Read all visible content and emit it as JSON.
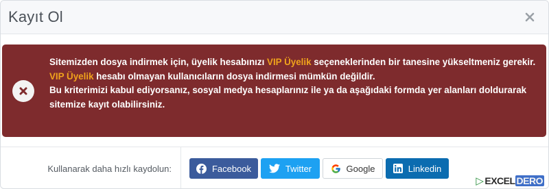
{
  "modal": {
    "title": "Kayıt Ol",
    "close_label": "×"
  },
  "alert": {
    "line1_pre": "Sitemizden dosya indirmek için, üyelik hesabınızı ",
    "line1_highlight": "VIP Üyelik",
    "line1_post": " seçeneklerinden bir tanesine yükseltmeniz gerekir.",
    "line2_highlight": "VIP Üyelik",
    "line2_post": " hesabı olmayan kullanıcıların dosya indirmesi mümkün değildir.",
    "line3": "Bu kriterimizi kabul ediyorsanız, sosyal medya hesaplarınız ile ya da aşağıdaki formda yer alanları doldurarak sitemize kayıt olabilirsiniz.",
    "icon": "x-circle-icon",
    "background_color": "#7e2b2d",
    "highlight_color": "#f0a31c"
  },
  "social": {
    "label": "Kullanarak daha hızlı kaydolun:",
    "buttons": [
      {
        "label": "Facebook",
        "icon": "facebook-icon",
        "color": "#3b5b9c"
      },
      {
        "label": "Twitter",
        "icon": "twitter-icon",
        "color": "#1da1f2"
      },
      {
        "label": "Google",
        "icon": "google-icon",
        "color": "#ffffff"
      },
      {
        "label": "Linkedin",
        "icon": "linkedin-icon",
        "color": "#0b6cb0"
      }
    ]
  },
  "watermark": {
    "part1": "EXCEL",
    "part2": "DERO"
  }
}
